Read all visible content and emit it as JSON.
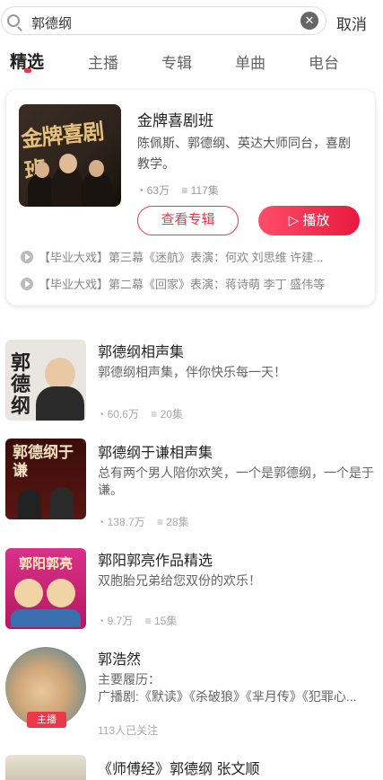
{
  "search": {
    "value": "郭德纲",
    "cancel_label": "取消"
  },
  "tabs": [
    {
      "label": "精选"
    },
    {
      "label": "主播"
    },
    {
      "label": "专辑"
    },
    {
      "label": "单曲"
    },
    {
      "label": "电台"
    }
  ],
  "album": {
    "cover_text": "金牌喜剧班",
    "title": "金牌喜剧班",
    "description": "陈佩斯、郭德纲、英达大师同台，喜剧教学。",
    "plays": "63万",
    "episodes": "117集",
    "view_label": "查看专辑",
    "play_label": "播放",
    "tracks": [
      "【毕业大戏】第三幕《迷航》表演：何欢 刘思维 许建...",
      "【毕业大戏】第二幕《回家》表演：蒋诗萌 李丁 盛伟等"
    ]
  },
  "results": [
    {
      "title": "郭德纲相声集",
      "desc": "郭德纲相声集，伴你快乐每一天！",
      "plays": "60.6万",
      "episodes": "20集",
      "cover_text": "郭德纲"
    },
    {
      "title": "郭德纲于谦相声集",
      "desc": "总有两个男人陪你欢笑，一个是郭德纲，一个是于谦。",
      "plays": "138.7万",
      "episodes": "28集",
      "cover_text": "郭德纲于谦"
    },
    {
      "title": "郭阳郭亮作品精选",
      "desc": "双胞胎兄弟给您双份的欢乐！",
      "plays": "9.7万",
      "episodes": "15集",
      "cover_text": "郭阳郭亮"
    },
    {
      "title": "郭浩然",
      "desc": "主要履历：",
      "desc2": "广播剧:《默读》《杀破狼》《芈月传》《犯罪心...",
      "followers": "113人已关注",
      "badge": "主播"
    },
    {
      "title": "《师傅经》郭德纲 张文顺"
    }
  ],
  "colors": {
    "accent": "#e83a4b"
  }
}
